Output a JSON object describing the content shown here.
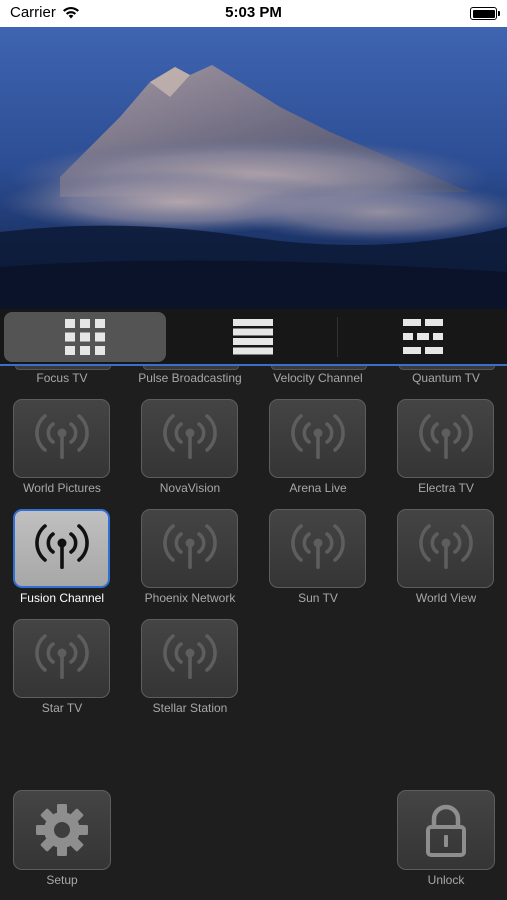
{
  "status_bar": {
    "carrier": "Carrier",
    "time": "5:03 PM"
  },
  "preview": {
    "image_alt": "mountain-peak-above-clouds"
  },
  "view_tabs": [
    {
      "name": "grid-view",
      "icon": "grid-icon",
      "active": true
    },
    {
      "name": "list-view",
      "icon": "list-icon",
      "active": false
    },
    {
      "name": "compact-view",
      "icon": "compact-grid-icon",
      "active": false
    }
  ],
  "partial_row": [
    "Focus TV",
    "Pulse Broadcasting",
    "Velocity Channel",
    "Quantum TV"
  ],
  "channels": [
    {
      "label": "World Pictures",
      "selected": false
    },
    {
      "label": "NovaVision",
      "selected": false
    },
    {
      "label": "Arena Live",
      "selected": false
    },
    {
      "label": "Electra TV",
      "selected": false
    },
    {
      "label": "Fusion Channel",
      "selected": true
    },
    {
      "label": "Phoenix Network",
      "selected": false
    },
    {
      "label": "Sun TV",
      "selected": false
    },
    {
      "label": "World View",
      "selected": false
    },
    {
      "label": "Star TV",
      "selected": false
    },
    {
      "label": "Stellar Station",
      "selected": false
    }
  ],
  "bottom": {
    "setup_label": "Setup",
    "unlock_label": "Unlock"
  },
  "colors": {
    "accent": "#2f6fd6",
    "background": "#1e1e1e",
    "tile": "#404040"
  }
}
